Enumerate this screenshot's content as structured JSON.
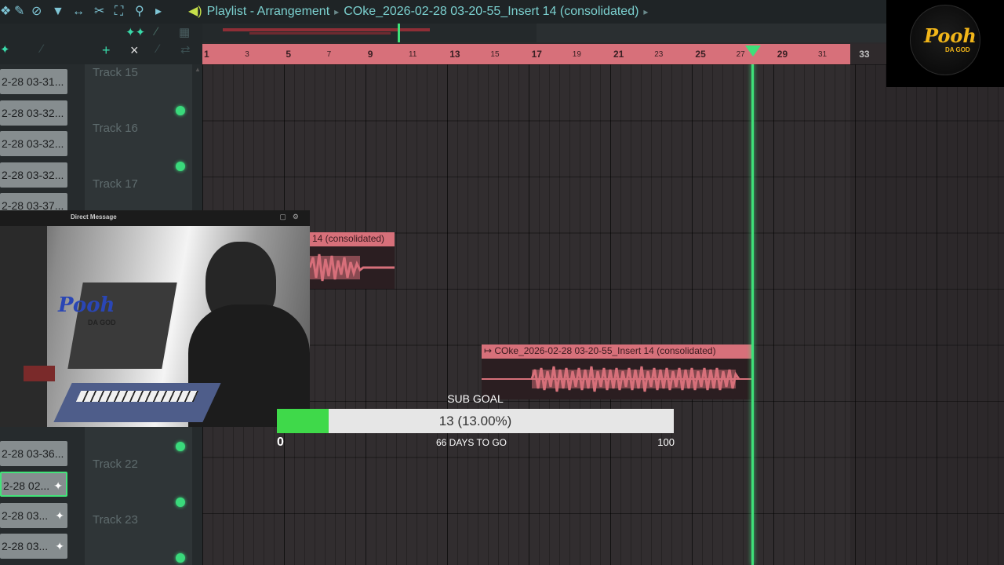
{
  "window": {
    "title": "Playlist - Arrangement",
    "pattern": "COke_2026-02-28 03-20-55_Insert 14 (consolidated)"
  },
  "ruler": {
    "bars": [
      "1",
      "3",
      "5",
      "7",
      "9",
      "11",
      "13",
      "15",
      "17",
      "19",
      "21",
      "23",
      "25",
      "27",
      "29",
      "31",
      "33"
    ]
  },
  "browser_clips": [
    "2-28 03-31...",
    "2-28 03-32...",
    "2-28 03-32...",
    "2-28 03-32...",
    "2-28 03-37...",
    "2-28 03-36...",
    "2-28 02...",
    "2-28 03...",
    "2-28 03..."
  ],
  "tracks": [
    "Track 15",
    "Track 16",
    "Track 17",
    "Track 22",
    "Track 23"
  ],
  "clips": [
    {
      "label": "14 (consolidated)"
    },
    {
      "label": "COke_2026-02-28 03-20-55_Insert 14 (consolidated)"
    }
  ],
  "webcam": {
    "title": "Direct Message",
    "overlay_text": "Pooh",
    "overlay_sub": "DA GOD"
  },
  "logo": {
    "text": "Pooh",
    "sub": "DA GOD"
  },
  "sub_goal": {
    "title": "SUB GOAL",
    "progress_text": "13 (13.00%)",
    "current": 13,
    "percent": 13.0,
    "min": "0",
    "max": "100",
    "days_left": "66 DAYS TO GO"
  },
  "colors": {
    "accent": "#3fe079",
    "clip": "#d7707a",
    "grid": "#312d2f"
  }
}
